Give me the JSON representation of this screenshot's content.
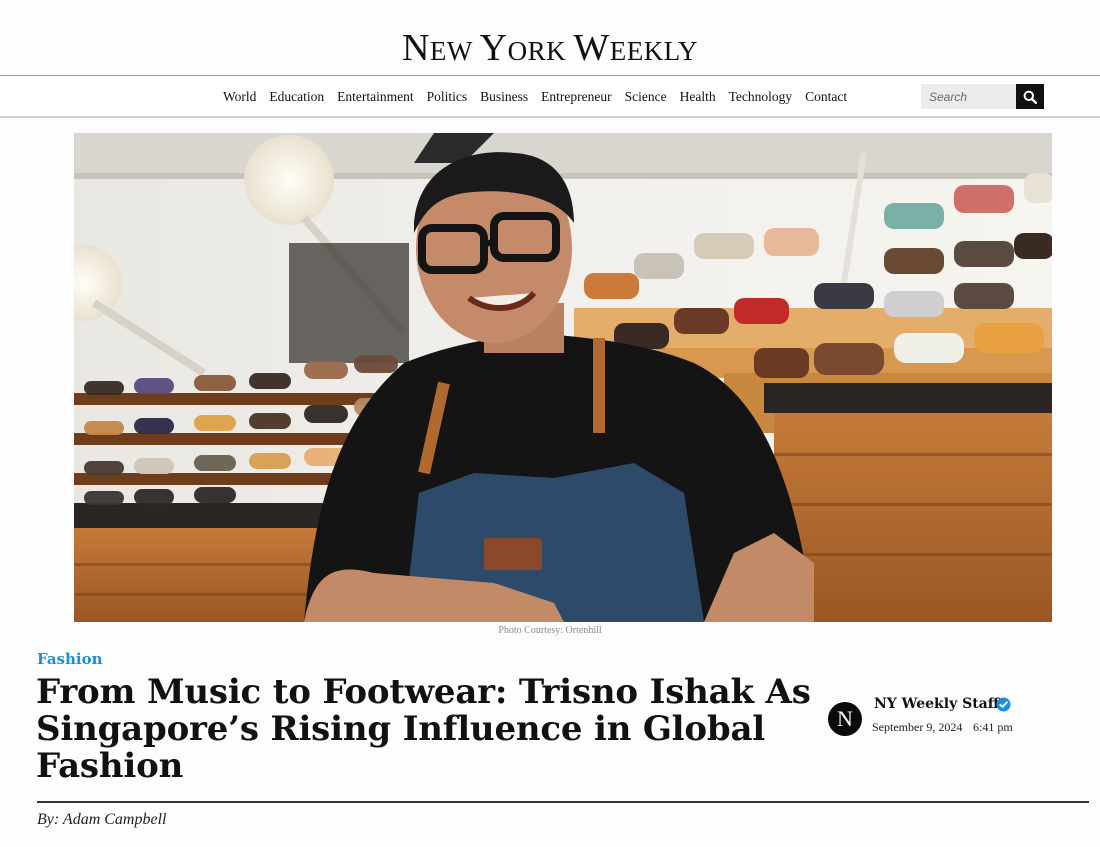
{
  "site": {
    "logo_first": "N",
    "logo_first_rest": "EW ",
    "logo_second": "Y",
    "logo_second_rest": "ORK ",
    "logo_third": "W",
    "logo_third_rest": "EEKLY"
  },
  "nav": {
    "items": [
      {
        "label": "World"
      },
      {
        "label": "Education"
      },
      {
        "label": "Entertainment"
      },
      {
        "label": "Politics"
      },
      {
        "label": "Business"
      },
      {
        "label": "Entrepreneur"
      },
      {
        "label": "Science"
      },
      {
        "label": "Health"
      },
      {
        "label": "Technology"
      },
      {
        "label": "Contact"
      }
    ],
    "search_placeholder": "Search",
    "search_icon": "search-icon"
  },
  "hero": {
    "caption": "Photo Courtesy: Ortenhill"
  },
  "article": {
    "category": "Fashion",
    "category_color": "#1d8fd8",
    "headline": "From Music to Footwear: Trisno Ishak As Singapore’s Rising Influence in Global Fashion",
    "author_initial": "N",
    "author_name": "NY Weekly Staff",
    "verified_icon": "verified-badge-icon",
    "date": "September 9, 2024",
    "time": "6:41 pm",
    "byline": "By: Adam Campbell"
  }
}
